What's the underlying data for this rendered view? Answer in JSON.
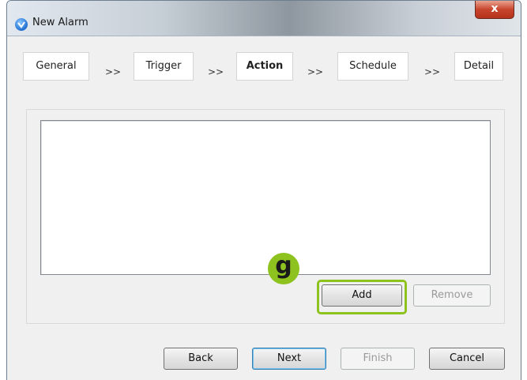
{
  "window": {
    "title": "New Alarm",
    "close_label": "x"
  },
  "steps": [
    {
      "label": "General",
      "active": false
    },
    {
      "label": "Trigger",
      "active": false
    },
    {
      "label": "Action",
      "active": true
    },
    {
      "label": "Schedule",
      "active": false
    },
    {
      "label": "Detail",
      "active": false
    }
  ],
  "step_separator": ">>",
  "action_panel": {
    "add_label": "Add",
    "remove_label": "Remove"
  },
  "annotation": {
    "badge_label": "g",
    "color": "#8dc21f"
  },
  "footer": {
    "back_label": "Back",
    "next_label": "Next",
    "finish_label": "Finish",
    "cancel_label": "Cancel"
  },
  "icons": {
    "app": "app-logo-icon",
    "close": "close-icon"
  }
}
